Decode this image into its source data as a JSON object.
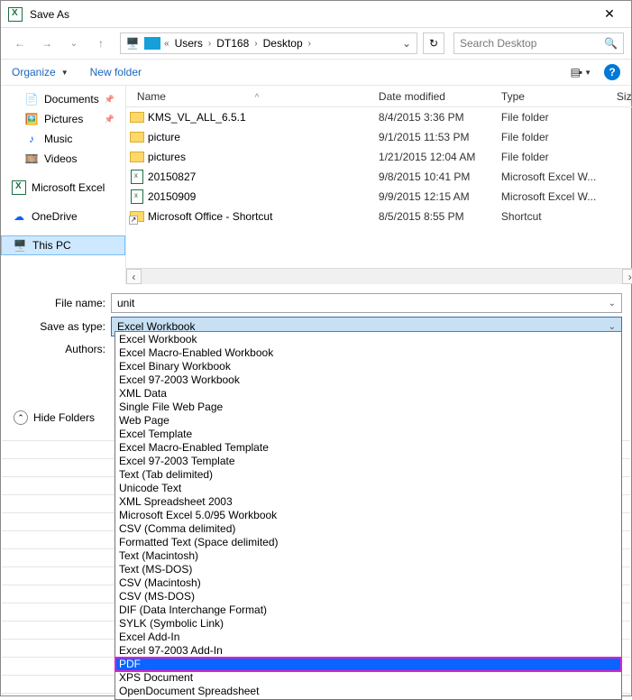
{
  "window": {
    "title": "Save As"
  },
  "nav": {
    "back": "←",
    "forward": "→",
    "up": "↑",
    "refresh": "↻"
  },
  "breadcrumb": {
    "prefix": "«",
    "segs": [
      "Users",
      "DT168",
      "Desktop"
    ]
  },
  "search": {
    "placeholder": "Search Desktop"
  },
  "toolbar": {
    "organize": "Organize",
    "newfolder": "New folder"
  },
  "navpane": {
    "items": [
      {
        "label": "Documents",
        "icon": "doc",
        "pin": true
      },
      {
        "label": "Pictures",
        "icon": "pic",
        "pin": true
      },
      {
        "label": "Music",
        "icon": "music",
        "pin": false
      },
      {
        "label": "Videos",
        "icon": "video",
        "pin": false
      }
    ],
    "excel": "Microsoft Excel",
    "onedrive": "OneDrive",
    "thispc": "This PC"
  },
  "columns": {
    "name": "Name",
    "date": "Date modified",
    "type": "Type",
    "size": "Size"
  },
  "files": [
    {
      "icon": "folder",
      "name": "KMS_VL_ALL_6.5.1",
      "date": "8/4/2015 3:36 PM",
      "type": "File folder"
    },
    {
      "icon": "folder",
      "name": "picture",
      "date": "9/1/2015 11:53 PM",
      "type": "File folder"
    },
    {
      "icon": "folder",
      "name": "pictures",
      "date": "1/21/2015 12:04 AM",
      "type": "File folder"
    },
    {
      "icon": "xls",
      "name": "20150827",
      "date": "9/8/2015 10:41 PM",
      "type": "Microsoft Excel W..."
    },
    {
      "icon": "xls",
      "name": "20150909",
      "date": "9/9/2015 12:15 AM",
      "type": "Microsoft Excel W..."
    },
    {
      "icon": "shortcut",
      "name": "Microsoft Office - Shortcut",
      "date": "8/5/2015 8:55 PM",
      "type": "Shortcut"
    }
  ],
  "form": {
    "filename_label": "File name:",
    "filename_value": "unit",
    "savetype_label": "Save as type:",
    "savetype_value": "Excel Workbook",
    "authors_label": "Authors:"
  },
  "hidefolders": "Hide Folders",
  "type_options": [
    "Excel Workbook",
    "Excel Macro-Enabled Workbook",
    "Excel Binary Workbook",
    "Excel 97-2003 Workbook",
    "XML Data",
    "Single File Web Page",
    "Web Page",
    "Excel Template",
    "Excel Macro-Enabled Template",
    "Excel 97-2003 Template",
    "Text (Tab delimited)",
    "Unicode Text",
    "XML Spreadsheet 2003",
    "Microsoft Excel 5.0/95 Workbook",
    "CSV (Comma delimited)",
    "Formatted Text (Space delimited)",
    "Text (Macintosh)",
    "Text (MS-DOS)",
    "CSV (Macintosh)",
    "CSV (MS-DOS)",
    "DIF (Data Interchange Format)",
    "SYLK (Symbolic Link)",
    "Excel Add-In",
    "Excel 97-2003 Add-In",
    "PDF",
    "XPS Document",
    "OpenDocument Spreadsheet"
  ],
  "highlight_option": "PDF"
}
